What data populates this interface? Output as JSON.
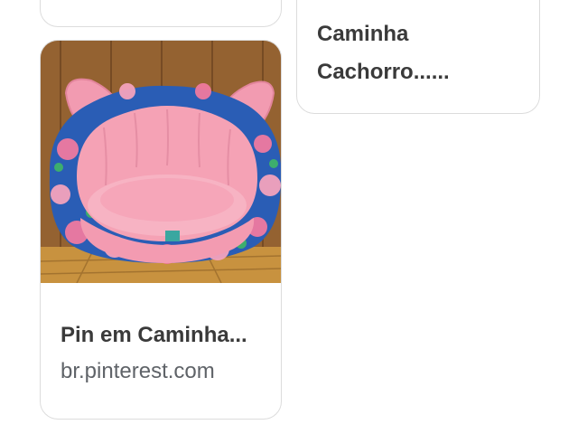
{
  "results": [
    {
      "title": "",
      "source": ""
    },
    {
      "title": "Caminha\nCachorro......",
      "source": ""
    },
    {
      "title": "Pin em Caminha...",
      "source": "br.pinterest.com",
      "image_alt": "pink pet bed with ears and floral border"
    }
  ]
}
